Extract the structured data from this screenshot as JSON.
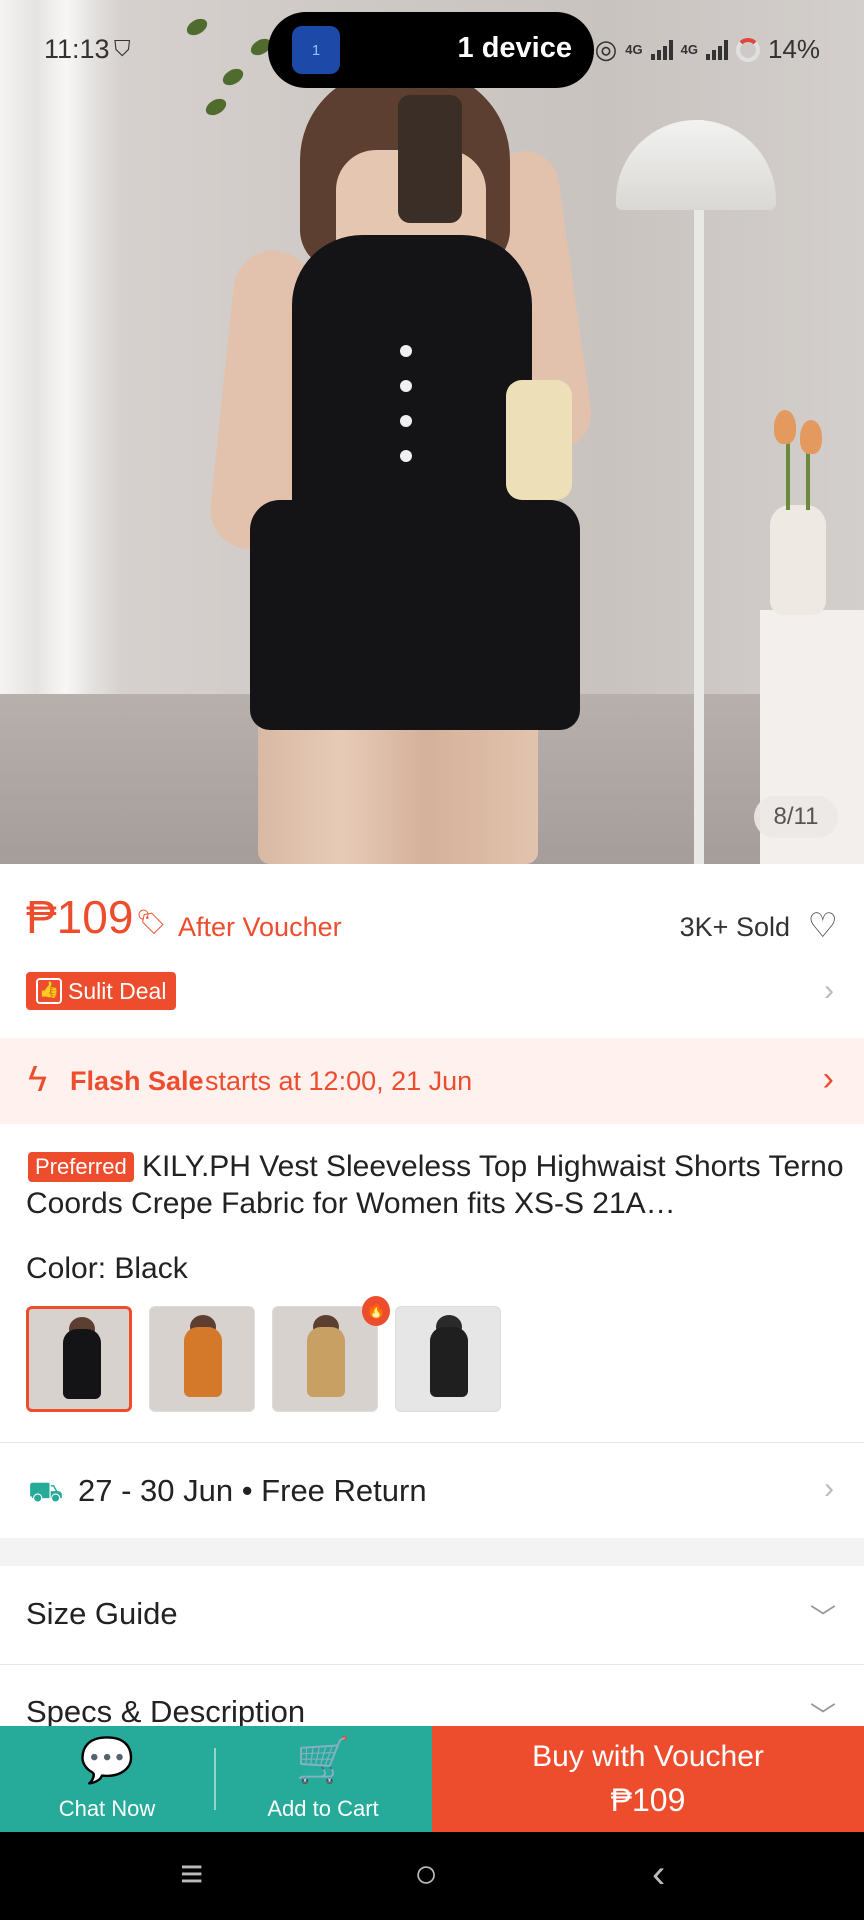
{
  "status_bar": {
    "time": "11:13",
    "pill_icon_text": "1",
    "device_text": "1 device",
    "net1": "4G",
    "net2": "4G",
    "battery": "14%"
  },
  "gallery": {
    "counter": "8/11"
  },
  "price": {
    "amount": "₱109",
    "after_voucher": "After Voucher",
    "sold": "3K+ Sold",
    "deal_badge": "Sulit Deal"
  },
  "flash_sale": {
    "title": "Flash Sale",
    "text": "starts at 12:00, 21 Jun"
  },
  "product": {
    "badge": "Preferred",
    "title": "KILY.PH Vest Sleeveless Top Highwaist Shorts Terno Coords Crepe Fabric for Women fits XS-S 21A…",
    "color_label": "Color: Black",
    "variants": [
      {
        "name": "Black",
        "color": "#141416"
      },
      {
        "name": "Orange",
        "color": "#d4792a"
      },
      {
        "name": "Tan",
        "color": "#c9a063"
      },
      {
        "name": "Gray",
        "color": "#bfbfbf"
      }
    ]
  },
  "shipping": {
    "text": "27 - 30 Jun • Free Return"
  },
  "sections": {
    "size_guide": "Size Guide",
    "specs": "Specs & Description"
  },
  "bottom_bar": {
    "chat": "Chat Now",
    "cart": "Add to Cart",
    "buy_line1": "Buy with Voucher",
    "buy_line2": "₱109"
  },
  "colors": {
    "accent": "#ee4d2d",
    "green": "#26aa99"
  }
}
